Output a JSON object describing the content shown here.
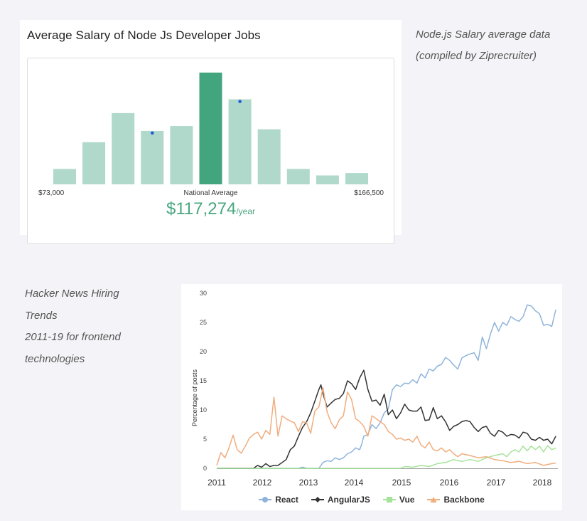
{
  "top_card": {
    "title": "Average Salary of Node Js Developer Jobs",
    "min_label": "$73,000",
    "max_label": "$166,500",
    "center_label": "National Average",
    "average_value": "$117,274",
    "average_unit": "/year"
  },
  "note_top": {
    "line1": "Node.js Salary average data",
    "line2": "(compiled by Ziprecruiter)"
  },
  "note_bottom": {
    "line1": "Hacker News Hiring",
    "line2": "Trends",
    "line3": "2011-19  for frontend",
    "line4": "technologies"
  },
  "colors": {
    "bar_light": "#b0d9cb",
    "bar_highlight": "#42a57e",
    "marker": "#1f5fd6",
    "react": "#8fb4dc",
    "angular": "#333333",
    "vue": "#a6e39a",
    "backbone": "#f0ad7e"
  },
  "chart_data": [
    {
      "type": "bar",
      "title": "Average Salary of Node Js Developer Jobs",
      "xlabel": "",
      "ylabel": "",
      "x_range": [
        "$73,000",
        "$166,500"
      ],
      "values": [
        19,
        52,
        88,
        66,
        72,
        138,
        105,
        68,
        19,
        11,
        14
      ],
      "highlight_index": 5,
      "marker_indices": [
        3,
        6
      ],
      "annotation": "National Average",
      "average": "$117,274/year"
    },
    {
      "type": "line",
      "title": "",
      "xlabel": "",
      "ylabel": "Percentage of posts",
      "ylim": [
        0,
        30
      ],
      "xlim": [
        2011,
        2018.35
      ],
      "xticks": [
        2011,
        2012,
        2013,
        2014,
        2015,
        2016,
        2017,
        2018
      ],
      "yticks": [
        0,
        5,
        10,
        15,
        20,
        25,
        30
      ],
      "grid": false,
      "legend": "bottom",
      "series": [
        {
          "name": "React",
          "color": "#8fb4dc",
          "points": [
            [
              2011.0,
              0
            ],
            [
              2013.0,
              0
            ],
            [
              2013.1,
              0.2
            ],
            [
              2013.2,
              0
            ],
            [
              2013.5,
              0
            ],
            [
              2013.6,
              1
            ],
            [
              2013.7,
              1.3
            ],
            [
              2013.8,
              1.2
            ],
            [
              2013.9,
              1.8
            ],
            [
              2014.0,
              1.5
            ],
            [
              2014.1,
              1.8
            ],
            [
              2014.2,
              2.5
            ],
            [
              2014.3,
              2.8
            ],
            [
              2014.4,
              3.5
            ],
            [
              2014.5,
              3.2
            ],
            [
              2014.55,
              4.2
            ],
            [
              2014.6,
              5.5
            ],
            [
              2014.7,
              5.8
            ],
            [
              2014.8,
              7.5
            ],
            [
              2014.9,
              6.8
            ],
            [
              2015.0,
              7.8
            ],
            [
              2015.1,
              9.5
            ],
            [
              2015.2,
              10.2
            ],
            [
              2015.3,
              13.5
            ],
            [
              2015.4,
              14.3
            ],
            [
              2015.5,
              14.0
            ],
            [
              2015.6,
              14.6
            ],
            [
              2015.7,
              14.5
            ],
            [
              2015.8,
              15.2
            ],
            [
              2015.9,
              14.6
            ],
            [
              2016.0,
              16.2
            ],
            [
              2016.1,
              15.5
            ],
            [
              2016.2,
              17.0
            ],
            [
              2016.3,
              16.7
            ],
            [
              2016.4,
              17.5
            ],
            [
              2016.5,
              17.8
            ],
            [
              2016.6,
              19.0
            ],
            [
              2016.7,
              18.5
            ],
            [
              2016.8,
              17.7
            ],
            [
              2016.9,
              17.0
            ],
            [
              2017.0,
              18.9
            ],
            [
              2017.1,
              19.3
            ],
            [
              2017.2,
              19.6
            ],
            [
              2017.3,
              19.8
            ],
            [
              2017.4,
              18.5
            ],
            [
              2017.5,
              22.5
            ],
            [
              2017.6,
              20.5
            ],
            [
              2017.7,
              23.0
            ],
            [
              2017.8,
              25.0
            ],
            [
              2017.9,
              23.5
            ],
            [
              2018.0,
              25.0
            ],
            [
              2018.1,
              24.5
            ],
            [
              2018.2,
              26.0
            ],
            [
              2018.3,
              25.5
            ],
            [
              2018.4,
              25.2
            ],
            [
              2018.5,
              26.0
            ],
            [
              2018.6,
              28.0
            ],
            [
              2018.7,
              27.8
            ],
            [
              2018.8,
              27.0
            ],
            [
              2018.9,
              26.5
            ],
            [
              2019.0,
              24.5
            ],
            [
              2019.1,
              24.7
            ],
            [
              2019.2,
              24.3
            ],
            [
              2019.3,
              27.2
            ]
          ]
        },
        {
          "name": "AngularJS",
          "color": "#333333",
          "points": [
            [
              2011.0,
              0
            ],
            [
              2011.9,
              0
            ],
            [
              2012.0,
              0.5
            ],
            [
              2012.1,
              0.2
            ],
            [
              2012.2,
              0.8
            ],
            [
              2012.3,
              0.3
            ],
            [
              2012.4,
              0.5
            ],
            [
              2012.5,
              0.5
            ],
            [
              2012.6,
              1
            ],
            [
              2012.7,
              1.5
            ],
            [
              2012.8,
              3.2
            ],
            [
              2012.9,
              3.8
            ],
            [
              2013.0,
              5.5
            ],
            [
              2013.1,
              7.0
            ],
            [
              2013.2,
              8.0
            ],
            [
              2013.3,
              9.5
            ],
            [
              2013.4,
              11.5
            ],
            [
              2013.5,
              13.5
            ],
            [
              2013.55,
              14.3
            ],
            [
              2013.6,
              12.8
            ],
            [
              2013.7,
              10.5
            ],
            [
              2013.8,
              11.2
            ],
            [
              2013.9,
              11.8
            ],
            [
              2014.0,
              12.0
            ],
            [
              2014.1,
              12.8
            ],
            [
              2014.2,
              15.0
            ],
            [
              2014.3,
              14.5
            ],
            [
              2014.4,
              13.5
            ],
            [
              2014.5,
              15.5
            ],
            [
              2014.6,
              16.8
            ],
            [
              2014.7,
              13.5
            ],
            [
              2014.8,
              11.5
            ],
            [
              2014.9,
              11.7
            ],
            [
              2015.0,
              10.8
            ],
            [
              2015.1,
              12.7
            ],
            [
              2015.2,
              9.2
            ],
            [
              2015.3,
              10.0
            ],
            [
              2015.4,
              8.5
            ],
            [
              2015.5,
              9.5
            ],
            [
              2015.6,
              11.0
            ],
            [
              2015.7,
              10.0
            ],
            [
              2015.8,
              9.8
            ],
            [
              2015.9,
              9.8
            ],
            [
              2016.0,
              10.5
            ],
            [
              2016.1,
              8.2
            ],
            [
              2016.2,
              8.3
            ],
            [
              2016.3,
              10.4
            ],
            [
              2016.4,
              8.5
            ],
            [
              2016.5,
              9.0
            ],
            [
              2016.6,
              8.0
            ],
            [
              2016.7,
              6.5
            ],
            [
              2016.8,
              7.2
            ],
            [
              2016.9,
              7.5
            ],
            [
              2017.0,
              8.0
            ],
            [
              2017.1,
              8.2
            ],
            [
              2017.2,
              8.0
            ],
            [
              2017.3,
              7.0
            ],
            [
              2017.4,
              6.3
            ],
            [
              2017.5,
              7.0
            ],
            [
              2017.6,
              7.2
            ],
            [
              2017.7,
              6.0
            ],
            [
              2017.8,
              5.5
            ],
            [
              2017.9,
              6.5
            ],
            [
              2018.0,
              6.2
            ],
            [
              2018.1,
              5.5
            ],
            [
              2018.2,
              5.8
            ],
            [
              2018.3,
              5.7
            ],
            [
              2018.4,
              5.2
            ],
            [
              2018.5,
              6.2
            ],
            [
              2018.6,
              6.0
            ],
            [
              2018.7,
              5.0
            ],
            [
              2018.8,
              4.8
            ],
            [
              2018.9,
              5.3
            ],
            [
              2019.0,
              4.8
            ],
            [
              2019.1,
              5.0
            ],
            [
              2019.2,
              4.2
            ],
            [
              2019.3,
              5.5
            ]
          ]
        },
        {
          "name": "Vue",
          "color": "#a6e39a",
          "points": [
            [
              2011.0,
              0
            ],
            [
              2015.5,
              0
            ],
            [
              2015.6,
              0.3
            ],
            [
              2015.8,
              0.2
            ],
            [
              2016.0,
              0.5
            ],
            [
              2016.2,
              0.3
            ],
            [
              2016.4,
              0.8
            ],
            [
              2016.6,
              1.0
            ],
            [
              2016.8,
              1.5
            ],
            [
              2016.9,
              1.3
            ],
            [
              2017.0,
              1.2
            ],
            [
              2017.2,
              1.5
            ],
            [
              2017.4,
              1.2
            ],
            [
              2017.6,
              1.8
            ],
            [
              2017.8,
              2.2
            ],
            [
              2018.0,
              2.5
            ],
            [
              2018.1,
              2.0
            ],
            [
              2018.2,
              2.8
            ],
            [
              2018.3,
              3.2
            ],
            [
              2018.4,
              2.8
            ],
            [
              2018.5,
              3.8
            ],
            [
              2018.6,
              3.0
            ],
            [
              2018.7,
              3.8
            ],
            [
              2018.8,
              3.2
            ],
            [
              2018.9,
              3.8
            ],
            [
              2019.0,
              2.8
            ],
            [
              2019.1,
              3.9
            ],
            [
              2019.2,
              3.2
            ],
            [
              2019.3,
              3.5
            ]
          ]
        },
        {
          "name": "Backbone",
          "color": "#f0ad7e",
          "points": [
            [
              2011.0,
              0.5
            ],
            [
              2011.1,
              2.7
            ],
            [
              2011.2,
              1.8
            ],
            [
              2011.3,
              3.5
            ],
            [
              2011.4,
              5.7
            ],
            [
              2011.5,
              3.2
            ],
            [
              2011.6,
              2.6
            ],
            [
              2011.7,
              3.8
            ],
            [
              2011.8,
              5.2
            ],
            [
              2011.9,
              5.8
            ],
            [
              2012.0,
              6.2
            ],
            [
              2012.1,
              5.0
            ],
            [
              2012.2,
              6.5
            ],
            [
              2012.3,
              5.8
            ],
            [
              2012.4,
              12.2
            ],
            [
              2012.5,
              5.5
            ],
            [
              2012.6,
              9.0
            ],
            [
              2012.7,
              8.5
            ],
            [
              2012.8,
              8.1
            ],
            [
              2012.9,
              7.8
            ],
            [
              2013.0,
              6.3
            ],
            [
              2013.1,
              8.0
            ],
            [
              2013.2,
              7.8
            ],
            [
              2013.3,
              6.0
            ],
            [
              2013.4,
              9.8
            ],
            [
              2013.5,
              10.5
            ],
            [
              2013.6,
              13.8
            ],
            [
              2013.7,
              9.7
            ],
            [
              2013.8,
              7.8
            ],
            [
              2013.9,
              6.8
            ],
            [
              2014.0,
              8.3
            ],
            [
              2014.1,
              9.0
            ],
            [
              2014.2,
              13.1
            ],
            [
              2014.3,
              11.8
            ],
            [
              2014.4,
              8.5
            ],
            [
              2014.5,
              8.0
            ],
            [
              2014.6,
              7.2
            ],
            [
              2014.7,
              5.5
            ],
            [
              2014.8,
              9.0
            ],
            [
              2014.9,
              8.5
            ],
            [
              2015.0,
              8.0
            ],
            [
              2015.1,
              7.5
            ],
            [
              2015.2,
              6.3
            ],
            [
              2015.3,
              5.8
            ],
            [
              2015.4,
              5.0
            ],
            [
              2015.5,
              5.2
            ],
            [
              2015.6,
              4.8
            ],
            [
              2015.7,
              5.0
            ],
            [
              2015.8,
              4.5
            ],
            [
              2015.9,
              5.5
            ],
            [
              2016.0,
              4.0
            ],
            [
              2016.1,
              3.5
            ],
            [
              2016.2,
              4.5
            ],
            [
              2016.3,
              3.2
            ],
            [
              2016.4,
              3.0
            ],
            [
              2016.5,
              3.5
            ],
            [
              2016.6,
              2.8
            ],
            [
              2016.7,
              3.2
            ],
            [
              2016.8,
              2.5
            ],
            [
              2016.9,
              2.0
            ],
            [
              2017.0,
              2.5
            ],
            [
              2017.2,
              2.2
            ],
            [
              2017.4,
              1.8
            ],
            [
              2017.6,
              2.0
            ],
            [
              2017.8,
              1.5
            ],
            [
              2018.0,
              1.3
            ],
            [
              2018.2,
              1.0
            ],
            [
              2018.4,
              1.2
            ],
            [
              2018.6,
              0.8
            ],
            [
              2018.8,
              1.0
            ],
            [
              2019.0,
              0.5
            ],
            [
              2019.2,
              0.8
            ],
            [
              2019.3,
              0.9
            ]
          ]
        }
      ]
    }
  ]
}
